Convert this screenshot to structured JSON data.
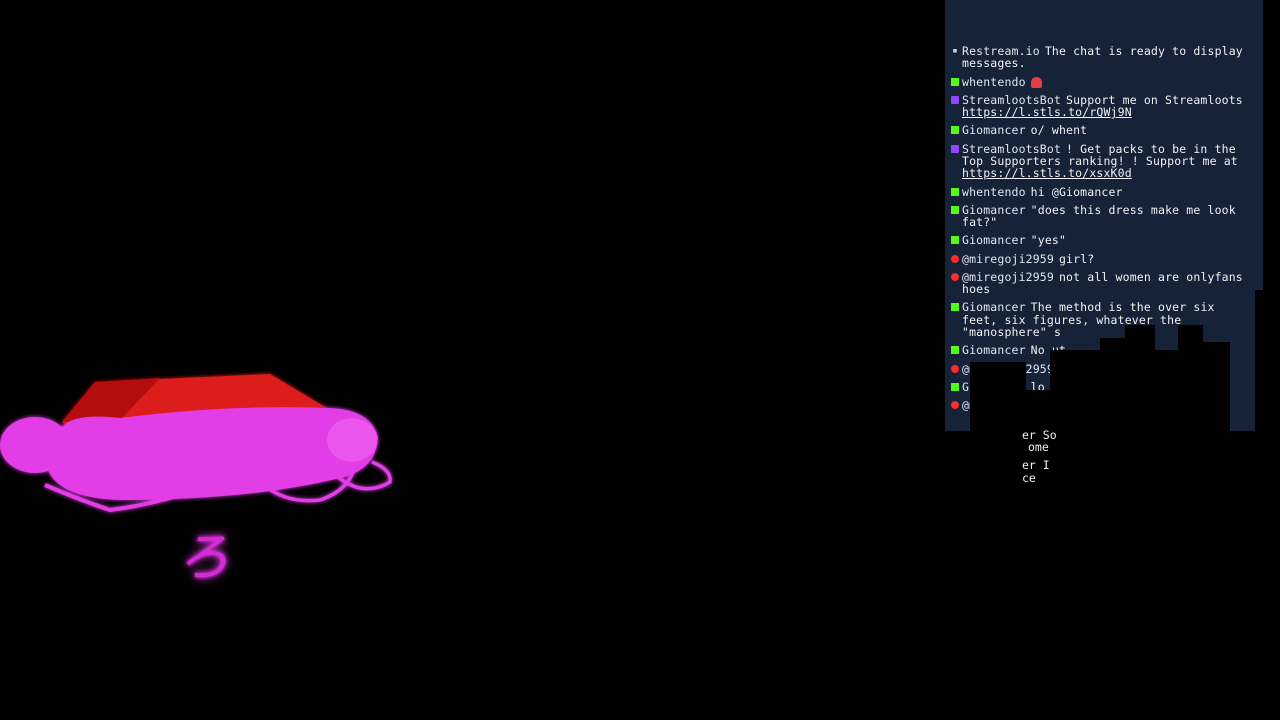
{
  "stream": {
    "overlay_glyph": "ろ"
  },
  "chat": {
    "messages": [
      {
        "platform": "restream",
        "user": "Restream.io",
        "text": "The chat is ready to display messages."
      },
      {
        "platform": "kick",
        "user": "whentendo",
        "text": "",
        "emote": "red-emote-icon"
      },
      {
        "platform": "twitch",
        "user": "StreamlootsBot",
        "text": "Support me on Streamloots ",
        "link": "https://l.stls.to/rQWj9N"
      },
      {
        "platform": "kick",
        "user": "Giomancer",
        "text": "o/ whent"
      },
      {
        "platform": "twitch",
        "user": "StreamlootsBot",
        "text": "! Get packs to be in the Top Supporters ranking! ! Support me at ",
        "link": "https://l.stls.to/xsxK0d"
      },
      {
        "platform": "kick",
        "user": "whentendo",
        "text": "hi @Giomancer"
      },
      {
        "platform": "kick",
        "user": "Giomancer",
        "text": "\"does this dress make me look fat?\""
      },
      {
        "platform": "kick",
        "user": "Giomancer",
        "text": "\"yes\""
      },
      {
        "platform": "youtube",
        "user": "@miregoji2959",
        "text": "girl?"
      },
      {
        "platform": "youtube",
        "user": "@miregoji2959",
        "text": "not all women are onlyfans hoes"
      },
      {
        "platform": "kick",
        "user": "Giomancer",
        "text": "The method is the over six feet, six figures, whatever the \"manosphere\" s"
      },
      {
        "platform": "kick",
        "user": "Giomancer",
        "text": "No ut"
      },
      {
        "platform": "youtube",
        "user": "@miregoji2959",
        "text": "N"
      },
      {
        "platform": "kick",
        "user": "Giomancer",
        "text": "lo"
      },
      {
        "platform": "youtube",
        "user": "@miregoji29",
        "text": ""
      }
    ],
    "spill_lines": [
      "er So",
      "ome",
      "er I",
      "ce"
    ]
  },
  "colors": {
    "chat_bg": "#152238",
    "hat_red": "#e01818",
    "hat_pink": "#e23ee6"
  }
}
